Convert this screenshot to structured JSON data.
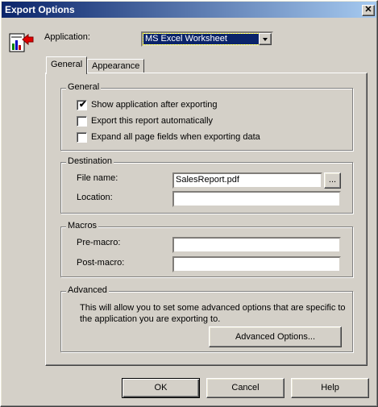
{
  "window": {
    "title": "Export Options",
    "close_glyph": "✕"
  },
  "header": {
    "icon": "export-report-icon",
    "application_label": "Application:",
    "application_value": "MS Excel Worksheet"
  },
  "tabs": [
    {
      "label": "General",
      "active": true
    },
    {
      "label": "Appearance",
      "active": false
    }
  ],
  "general_group": {
    "title": "General",
    "options": [
      {
        "label": "Show application after exporting",
        "checked": true
      },
      {
        "label": "Export this report automatically",
        "checked": false
      },
      {
        "label": "Expand all page fields when exporting data",
        "checked": false
      }
    ]
  },
  "destination_group": {
    "title": "Destination",
    "file_name_label": "File name:",
    "file_name_value": "SalesReport.pdf",
    "browse_label": "...",
    "location_label": "Location:",
    "location_value": ""
  },
  "macros_group": {
    "title": "Macros",
    "pre_macro_label": "Pre-macro:",
    "pre_macro_value": "",
    "post_macro_label": "Post-macro:",
    "post_macro_value": ""
  },
  "advanced_group": {
    "title": "Advanced",
    "description": "This will allow you to set some advanced options that are specific to the application you are exporting to.",
    "button_label": "Advanced Options..."
  },
  "footer": {
    "ok_label": "OK",
    "cancel_label": "Cancel",
    "help_label": "Help"
  },
  "colors": {
    "title_bar_start": "#0a246a",
    "title_bar_end": "#a6caf0",
    "dialog_background": "#d4d0c8",
    "selection": "#0a246a"
  }
}
